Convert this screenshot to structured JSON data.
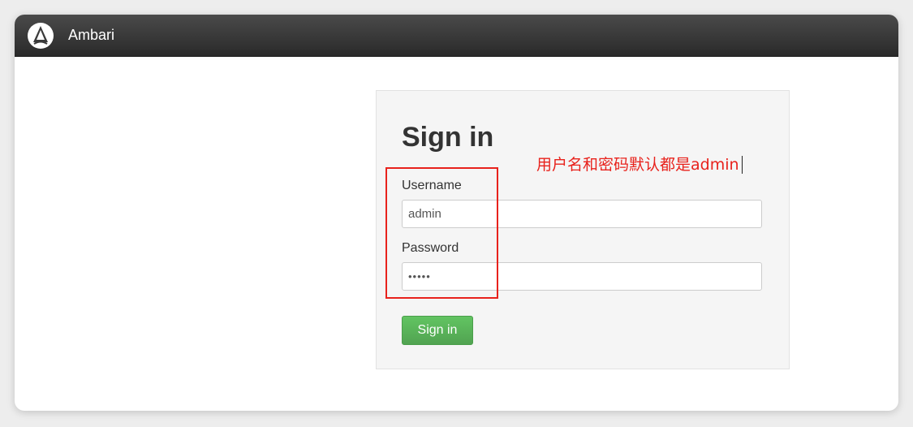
{
  "header": {
    "brand": "Ambari",
    "logo_icon": "ambari-logo-icon"
  },
  "signin": {
    "title": "Sign in",
    "annotation": "用户名和密码默认都是admin",
    "username_label": "Username",
    "username_value": "admin",
    "password_label": "Password",
    "password_value": "•••••",
    "button_label": "Sign in"
  },
  "colors": {
    "topbar": "#333333",
    "button": "#5bb75b",
    "annotation": "#e8221c",
    "panel": "#f5f5f5"
  }
}
